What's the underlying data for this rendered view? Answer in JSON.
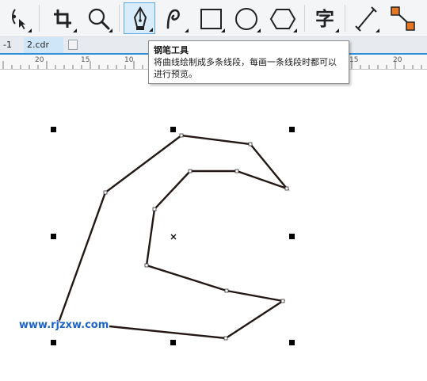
{
  "toolbar": {
    "tools": [
      {
        "name": "shape-tool"
      },
      {
        "name": "crop-tool"
      },
      {
        "name": "zoom-tool"
      },
      {
        "name": "pen-tool",
        "active": true
      },
      {
        "name": "artistic-media-tool"
      },
      {
        "name": "rectangle-tool"
      },
      {
        "name": "ellipse-tool"
      },
      {
        "name": "polygon-tool"
      },
      {
        "name": "text-tool",
        "glyph": "字"
      },
      {
        "name": "parallel-dimension-tool"
      },
      {
        "name": "connector-tool"
      }
    ],
    "colors": {
      "active_bg": "#d8ecfb",
      "active_border": "#5fa8e0",
      "connector_nodes": "#e87722"
    }
  },
  "tabs": {
    "items": [
      {
        "label": "-1",
        "active": false
      },
      {
        "label": "2.cdr",
        "active": true
      }
    ]
  },
  "ruler": {
    "ticks": [
      "20",
      "15",
      "10",
      "15",
      "20"
    ]
  },
  "tooltip": {
    "title": "钢笔工具",
    "body": "将曲线绘制成多条线段，每画一条线段时都可以进行预览。"
  },
  "watermark": "www.rjzxw.com",
  "drawing": {
    "stroke_color": "#231815"
  }
}
